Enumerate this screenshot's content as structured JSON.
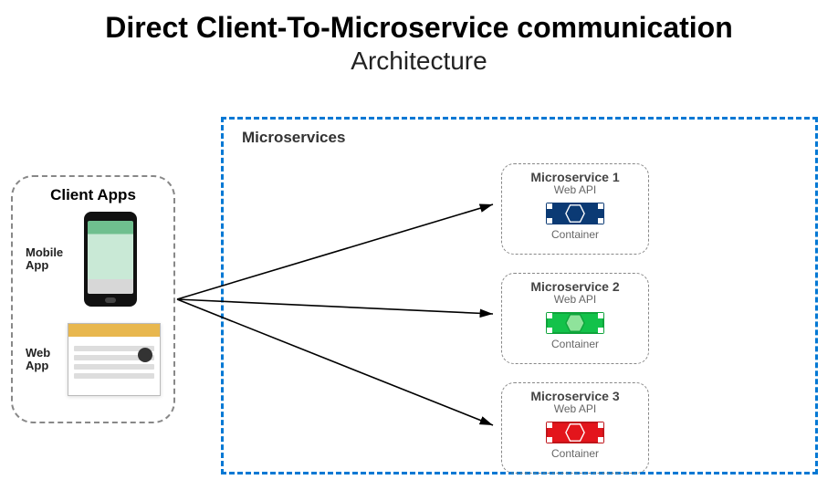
{
  "title": "Direct Client-To-Microservice communication",
  "subtitle": "Architecture",
  "clients": {
    "box_title": "Client Apps",
    "mobile_label": "Mobile App",
    "web_label": "Web App"
  },
  "microservices": {
    "section_label": "Microservices",
    "items": [
      {
        "name": "Microservice 1",
        "api": "Web API",
        "caption": "Container",
        "accent": "#0b3a74"
      },
      {
        "name": "Microservice 2",
        "api": "Web API",
        "caption": "Container",
        "accent": "#13c24a"
      },
      {
        "name": "Microservice 3",
        "api": "Web API",
        "caption": "Container",
        "accent": "#e3151c"
      }
    ]
  }
}
